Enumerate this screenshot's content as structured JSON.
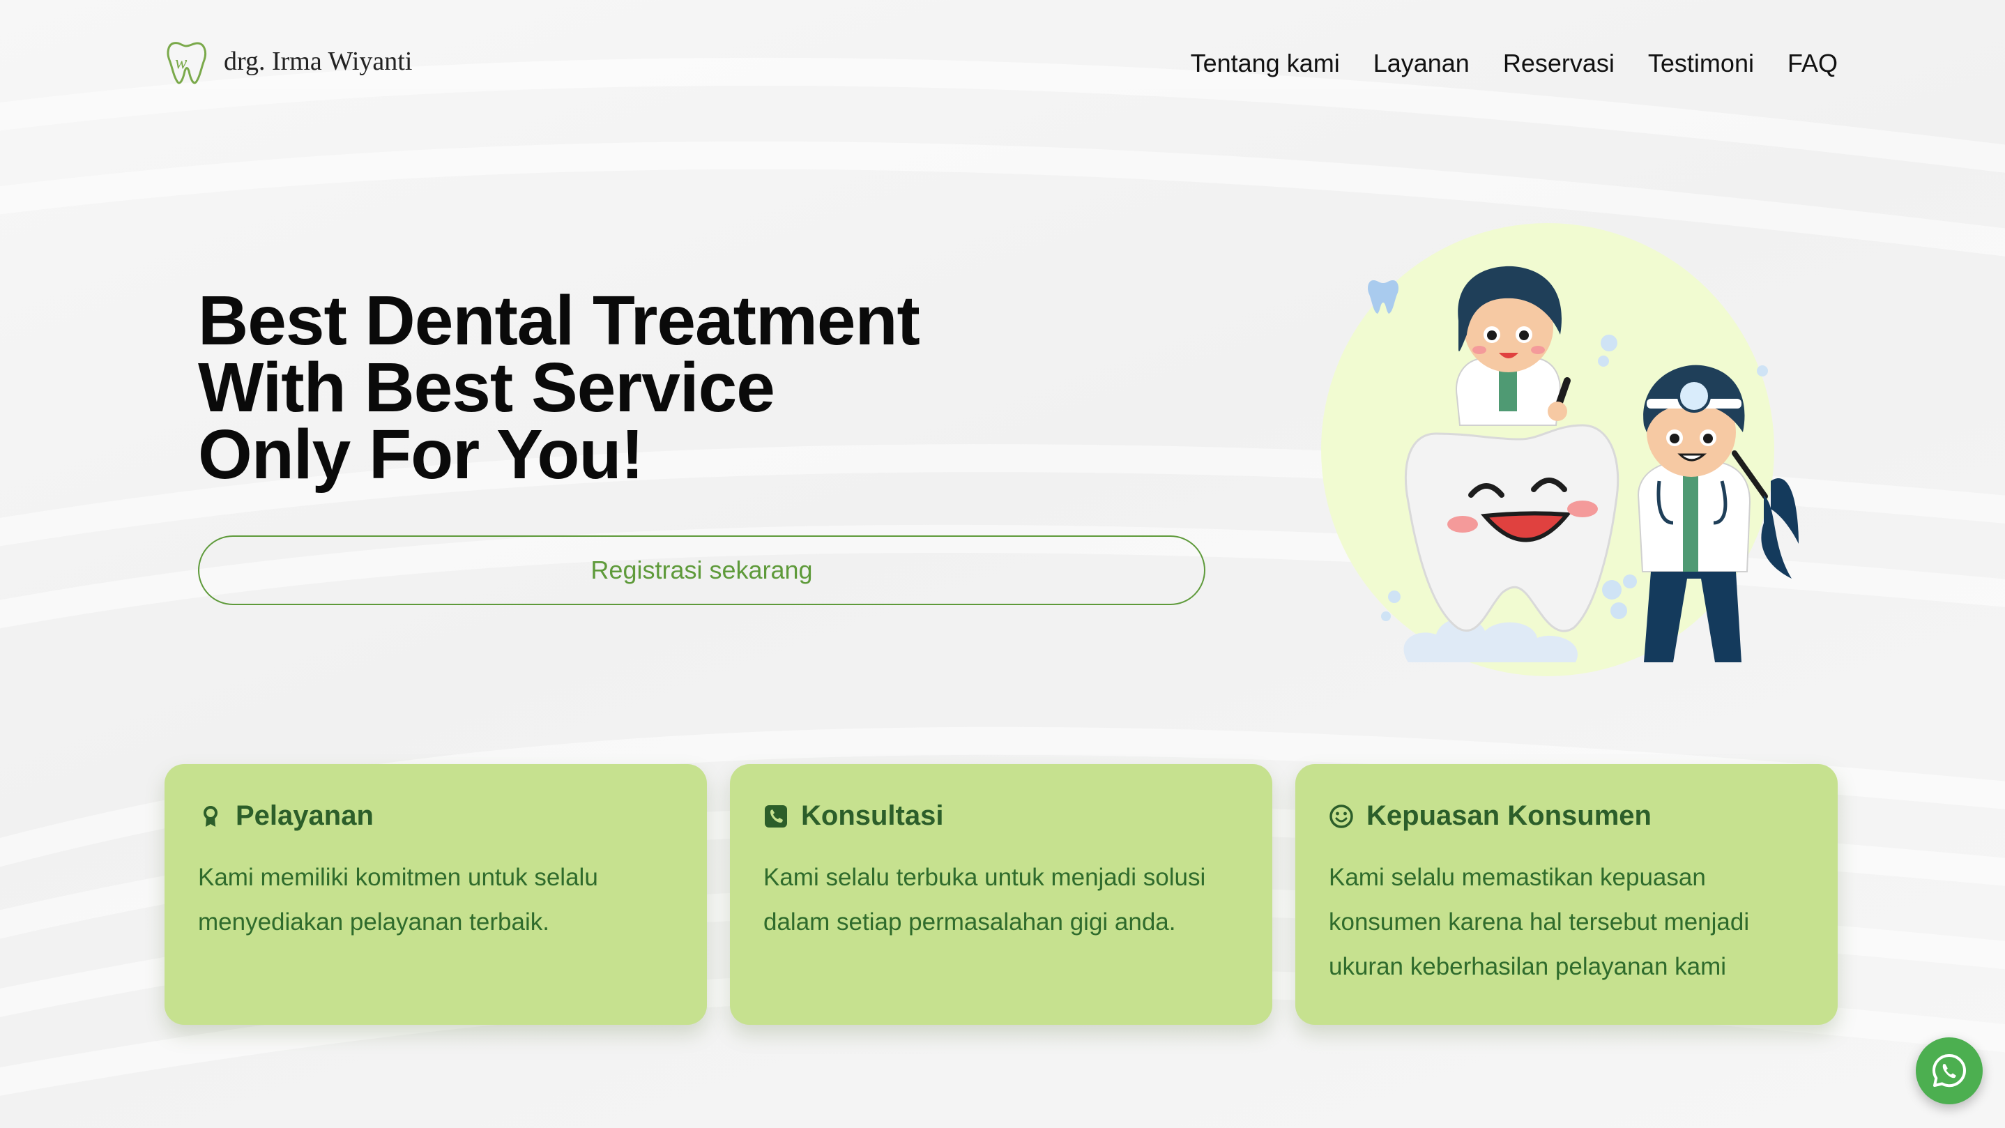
{
  "brand": {
    "name": "drg. Irma Wiyanti",
    "logo_icon": "tooth-logo-icon"
  },
  "nav": {
    "items": [
      {
        "label": "Tentang kami"
      },
      {
        "label": "Layanan"
      },
      {
        "label": "Reservasi"
      },
      {
        "label": "Testimoni"
      },
      {
        "label": "FAQ"
      }
    ]
  },
  "hero": {
    "title_lines": [
      "Best Dental Treatment",
      "With Best Service",
      "Only For You!"
    ],
    "cta_label": "Registrasi sekarang"
  },
  "cards": [
    {
      "icon": "award-ribbon-icon",
      "title": "Pelayanan",
      "lines": [
        "Kami memiliki komitmen untuk selalu",
        "menyediakan pelayanan terbaik."
      ]
    },
    {
      "icon": "phone-square-icon",
      "title": "Konsultasi",
      "lines": [
        "Kami selalu terbuka untuk menjadi solusi",
        "dalam setiap permasalahan gigi anda."
      ]
    },
    {
      "icon": "smiley-face-icon",
      "title": "Kepuasan Konsumen",
      "lines": [
        "Kami selalu memastikan kepuasan",
        "konsumen karena hal tersebut menjadi",
        "ukuran keberhasilan pelayanan kami"
      ]
    }
  ],
  "floating": {
    "icon": "whatsapp-icon"
  },
  "colors": {
    "accent": "#5e9a3a",
    "card_bg": "#c6e18f",
    "card_text": "#2f6b2c",
    "whatsapp": "#4caf50"
  }
}
